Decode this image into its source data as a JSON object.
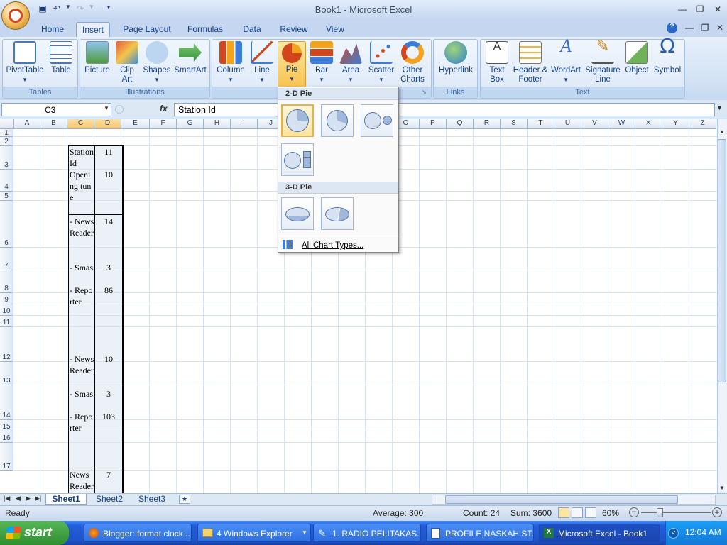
{
  "window": {
    "title": "Book1 - Microsoft Excel"
  },
  "ribbon_tabs": [
    "Home",
    "Insert",
    "Page Layout",
    "Formulas",
    "Data",
    "Review",
    "View"
  ],
  "groups": {
    "tables": {
      "label": "Tables",
      "buttons": [
        "PivotTable",
        "Table"
      ]
    },
    "illustrations": {
      "label": "Illustrations",
      "buttons": [
        "Picture",
        "Clip Art",
        "Shapes",
        "SmartArt"
      ]
    },
    "charts": {
      "buttons": [
        "Column",
        "Line",
        "Pie",
        "Bar",
        "Area",
        "Scatter",
        "Other Charts"
      ]
    },
    "links": {
      "label": "Links",
      "buttons": [
        "Hyperlink"
      ]
    },
    "text": {
      "label": "Text",
      "buttons": [
        "Text Box",
        "Header & Footer",
        "WordArt",
        "Signature Line",
        "Object",
        "Symbol"
      ]
    }
  },
  "formula_bar": {
    "name_box": "C3",
    "fx": "fx",
    "formula": "Station Id"
  },
  "columns": [
    "A",
    "B",
    "C",
    "D",
    "E",
    "F",
    "G",
    "H",
    "I",
    "J",
    "K",
    "L",
    "M",
    "N",
    "O",
    "P",
    "Q",
    "R",
    "S",
    "T",
    "U",
    "V",
    "W",
    "X",
    "Y",
    "Z"
  ],
  "rows": [
    "1",
    "2",
    "3",
    "4",
    "5",
    "6",
    "7",
    "8",
    "9",
    "10",
    "11",
    "12",
    "13",
    "14",
    "15",
    "16",
    "17"
  ],
  "cells": {
    "c3": "Station Id",
    "d3": "11",
    "c4": "Opening tune",
    "d4": "10",
    "c6": "- News Reader",
    "d6": "14",
    "c7": "- Smas",
    "d7": "3",
    "c8": "- Reporter",
    "d8": "86",
    "c12": "- News Reader",
    "d12": "10",
    "c13": "- Smas",
    "d13": "3",
    "c14": "- Reporter",
    "d14": "103",
    "c17": "News Reader",
    "d17": "7"
  },
  "pie_menu": {
    "section_2d": "2-D Pie",
    "section_3d": "3-D Pie",
    "all_charts": "All Chart Types..."
  },
  "sheets": [
    "Sheet1",
    "Sheet2",
    "Sheet3"
  ],
  "status": {
    "ready": "Ready",
    "average": "Average: 300",
    "count": "Count: 24",
    "sum": "Sum: 3600",
    "zoom": "60%"
  },
  "taskbar": {
    "start": "start",
    "items": [
      "Blogger: format clock ...",
      "4 Windows Explorer",
      "1. RADIO PELITAKAS...",
      "PROFILE,NASKAH ST...",
      "Microsoft Excel - Book1"
    ],
    "clock": "12:04 AM"
  }
}
